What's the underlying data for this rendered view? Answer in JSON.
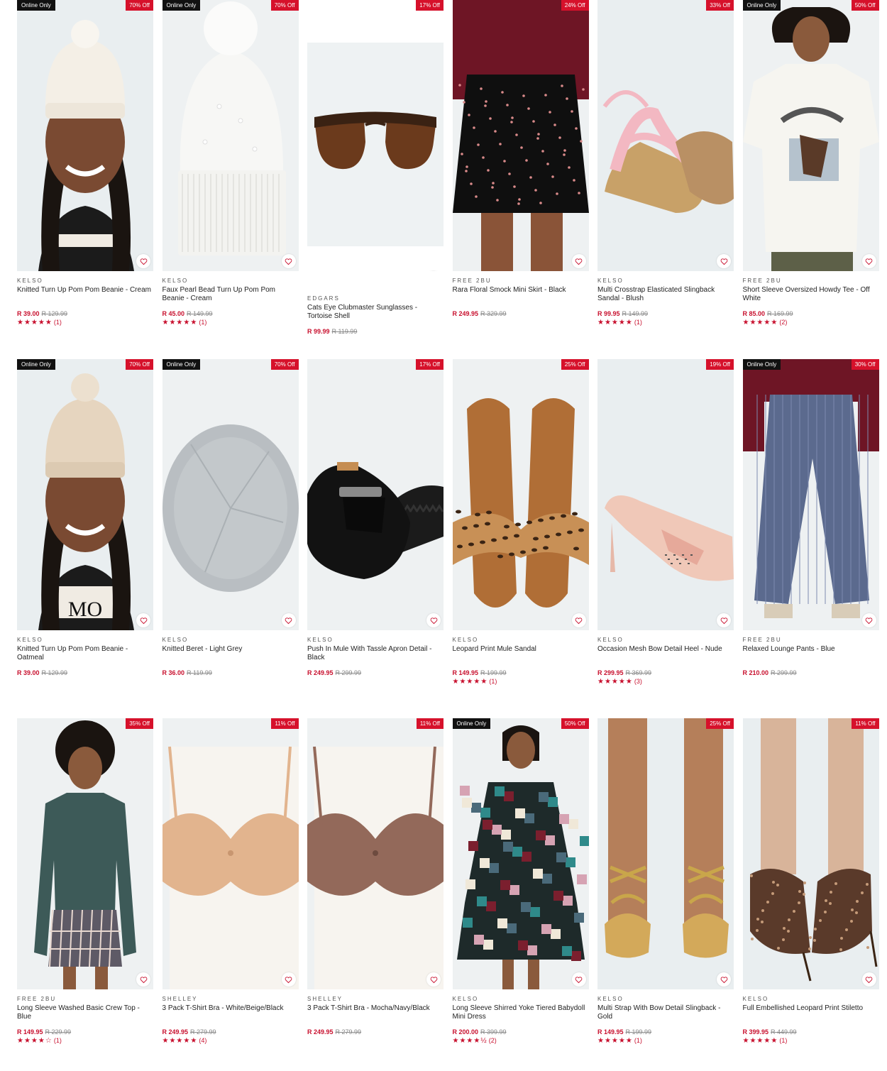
{
  "products": [
    {
      "badge_online": "Online Only",
      "badge_off": "70% Off",
      "brand": "KELSO",
      "name": "Knitted Turn Up Pom Pom Beanie - Cream",
      "price": "R 39.00",
      "was": "R 129.99",
      "stars": "★★★★★",
      "count": "(1)",
      "art": "beanie-cream"
    },
    {
      "badge_online": "Online Only",
      "badge_off": "70% Off",
      "brand": "KELSO",
      "name": "Faux Pearl Bead Turn Up Pom Pom Beanie - Cream",
      "price": "R 45.00",
      "was": "R 149.99",
      "stars": "★★★★★",
      "count": "(1)",
      "art": "beanie-white"
    },
    {
      "badge_online": "",
      "badge_off": "17% Off",
      "brand": "EDGARS",
      "name": "Cats Eye Clubmaster Sunglasses - Tortoise Shell",
      "price": "R 99.99",
      "was": "R 119.99",
      "stars": "",
      "count": "",
      "art": "sunglasses"
    },
    {
      "badge_online": "",
      "badge_off": "24% Off",
      "brand": "FREE 2BU",
      "name": "Rara Floral Smock Mini Skirt - Black",
      "price": "R 249.95",
      "was": "R 329.99",
      "stars": "",
      "count": "",
      "art": "skirt"
    },
    {
      "badge_online": "",
      "badge_off": "33% Off",
      "brand": "KELSO",
      "name": "Multi Crosstrap Elasticated Slingback Sandal - Blush",
      "price": "R 99.95",
      "was": "R 149.99",
      "stars": "★★★★★",
      "count": "(1)",
      "art": "sandal-pink"
    },
    {
      "badge_online": "Online Only",
      "badge_off": "50% Off",
      "brand": "FREE 2BU",
      "name": "Short Sleeve Oversized Howdy Tee - Off White",
      "price": "R 85.00",
      "was": "R 169.99",
      "stars": "★★★★★",
      "count": "(2)",
      "art": "tee"
    },
    {
      "badge_online": "Online Only",
      "badge_off": "70% Off",
      "brand": "KELSO",
      "name": "Knitted Turn Up Pom Pom Beanie - Oatmeal",
      "price": "R 39.00",
      "was": "R 129.99",
      "stars": "",
      "count": "",
      "art": "beanie-oat"
    },
    {
      "badge_online": "Online Only",
      "badge_off": "70% Off",
      "brand": "KELSO",
      "name": "Knitted Beret - Light Grey",
      "price": "R 36.00",
      "was": "R 119.99",
      "stars": "",
      "count": "",
      "art": "beret"
    },
    {
      "badge_online": "",
      "badge_off": "17% Off",
      "brand": "KELSO",
      "name": "Push In Mule With Tassle Apron Detail - Black",
      "price": "R 249.95",
      "was": "R 299.99",
      "stars": "",
      "count": "",
      "art": "mule"
    },
    {
      "badge_online": "",
      "badge_off": "25% Off",
      "brand": "KELSO",
      "name": "Leopard Print Mule Sandal",
      "price": "R 149.95",
      "was": "R 199.99",
      "stars": "★★★★★",
      "count": "(1)",
      "art": "leopard-sandal"
    },
    {
      "badge_online": "",
      "badge_off": "19% Off",
      "brand": "KELSO",
      "name": "Occasion Mesh Bow Detail Heel - Nude",
      "price": "R 299.95",
      "was": "R 369.99",
      "stars": "★★★★★",
      "count": "(3)",
      "art": "heel-nude"
    },
    {
      "badge_online": "Online Only",
      "badge_off": "30% Off",
      "brand": "FREE 2BU",
      "name": "Relaxed Lounge Pants - Blue",
      "price": "R 210.00",
      "was": "R 299.99",
      "stars": "",
      "count": "",
      "art": "pants"
    },
    {
      "badge_online": "",
      "badge_off": "35% Off",
      "brand": "FREE 2BU",
      "name": "Long Sleeve Washed Basic Crew Top - Blue",
      "price": "R 149.95",
      "was": "R 229.99",
      "stars": "★★★★☆",
      "count": "(1)",
      "art": "crew-top"
    },
    {
      "badge_online": "",
      "badge_off": "11% Off",
      "brand": "SHELLEY",
      "name": "3 Pack T-Shirt Bra - White/Beige/Black",
      "price": "R 249.95",
      "was": "R 279.99",
      "stars": "★★★★★",
      "count": "(4)",
      "art": "bra-beige"
    },
    {
      "badge_online": "",
      "badge_off": "11% Off",
      "brand": "SHELLEY",
      "name": "3 Pack T-Shirt Bra - Mocha/Navy/Black",
      "price": "R 249.95",
      "was": "R 279.99",
      "stars": "",
      "count": "",
      "art": "bra-mocha"
    },
    {
      "badge_online": "Online Only",
      "badge_off": "50% Off",
      "brand": "KELSO",
      "name": "Long Sleeve Shirred Yoke Tiered Babydoll Mini Dress",
      "price": "R 200.00",
      "was": "R 399.99",
      "stars": "★★★★½",
      "count": "(2)",
      "art": "dress"
    },
    {
      "badge_online": "",
      "badge_off": "25% Off",
      "brand": "KELSO",
      "name": "Multi Strap With Bow Detail Slingback - Gold",
      "price": "R 149.95",
      "was": "R 199.99",
      "stars": "★★★★★",
      "count": "(1)",
      "art": "gold-sandal"
    },
    {
      "badge_online": "",
      "badge_off": "11% Off",
      "brand": "KELSO",
      "name": "Full Embellished Leopard Print Stiletto",
      "price": "R 399.95",
      "was": "R 449.99",
      "stars": "★★★★★",
      "count": "(1)",
      "art": "stiletto"
    }
  ],
  "icons": {
    "wishlist": "heart-icon"
  },
  "colors": {
    "sale": "#c8102e",
    "badge_off": "#d6112b",
    "badge_online": "#111111"
  }
}
